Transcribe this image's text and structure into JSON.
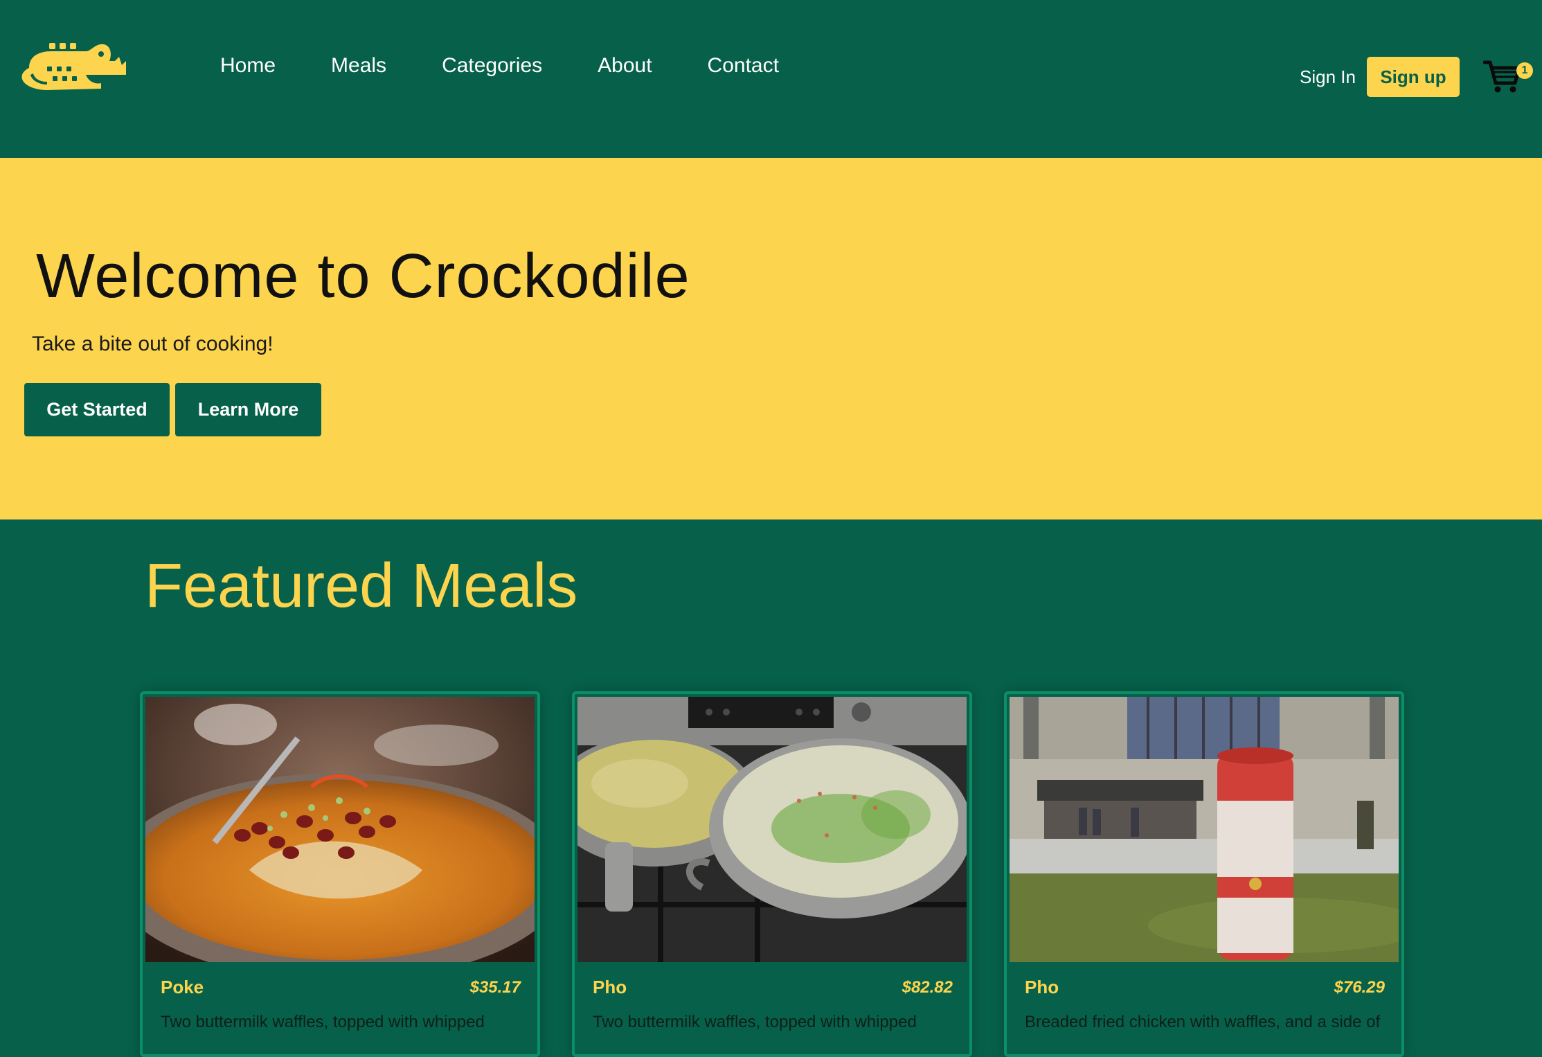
{
  "colors": {
    "green": "#07614a",
    "yellow": "#fdd44e",
    "card_border": "#0b8f68"
  },
  "brand": {
    "logo_icon": "crocodile-logo-icon"
  },
  "nav": {
    "links": [
      "Home",
      "Meals",
      "Categories",
      "About",
      "Contact"
    ],
    "signin_label": "Sign In",
    "signup_label": "Sign up",
    "cart_icon": "shopping-cart-icon",
    "cart_count": "1"
  },
  "hero": {
    "title": "Welcome to Crockodile",
    "subtitle": "Take a bite out of cooking!",
    "primary_button": "Get Started",
    "secondary_button": "Learn More"
  },
  "featured": {
    "title": "Featured Meals",
    "cards": [
      {
        "name": "Poke",
        "price": "$35.17",
        "description": "Two buttermilk waffles, topped with whipped",
        "image": "spicy-noodle-bowl-photo"
      },
      {
        "name": "Pho",
        "price": "$82.82",
        "description": "Two buttermilk waffles, topped with whipped",
        "image": "soup-pots-on-stove-photo"
      },
      {
        "name": "Pho",
        "price": "$76.29",
        "description": "Breaded fried chicken with waffles, and a side of",
        "image": "soup-can-sculpture-photo"
      }
    ]
  }
}
